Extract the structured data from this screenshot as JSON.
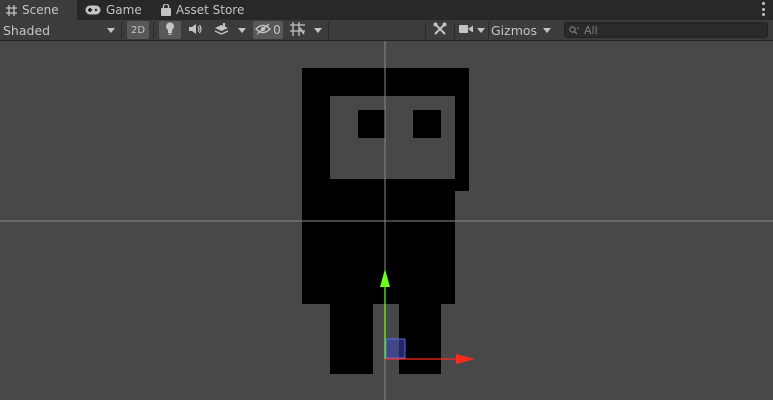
{
  "tabs": [
    {
      "label": "Scene",
      "icon": "grid-icon",
      "active": true
    },
    {
      "label": "Game",
      "icon": "gamepad-icon",
      "active": false
    },
    {
      "label": "Asset Store",
      "icon": "shopping-bag-icon",
      "active": false
    }
  ],
  "toolbar": {
    "shading_mode": "Shaded",
    "two_d_label": "2D",
    "hidden_count": "0",
    "gizmos_label": "Gizmos",
    "search_placeholder": "All"
  },
  "colors": {
    "viewport_bg": "#484848",
    "toolbar_bg": "#3c3c3c",
    "tabbar_bg": "#282828",
    "sprite": "#000000",
    "sprite_face": "#484848",
    "axis_x": "#ff2a1a",
    "axis_y": "#6cff1a",
    "axis_z_plane": "#3c45b8"
  }
}
